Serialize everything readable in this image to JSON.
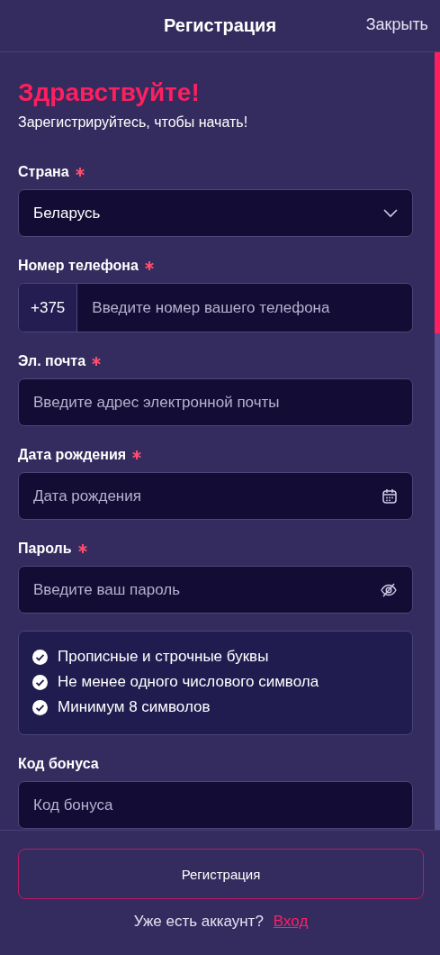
{
  "header": {
    "title": "Регистрация",
    "close": "Закрыть"
  },
  "greeting": {
    "title": "Здравствуйте!",
    "subtitle": "Зарегистрируйтесь, чтобы начать!"
  },
  "fields": [
    {
      "kind": "select",
      "label": "Страна",
      "required": true,
      "value": "Беларусь"
    },
    {
      "kind": "phone",
      "label": "Номер телефона",
      "required": true,
      "prefix": "+375",
      "placeholder": "Введите номер вашего телефона"
    },
    {
      "kind": "text",
      "label": "Эл. почта",
      "required": true,
      "placeholder": "Введите адрес электронной почты"
    },
    {
      "kind": "date",
      "label": "Дата рождения",
      "required": true,
      "placeholder": "Дата рождения"
    },
    {
      "kind": "password",
      "label": "Пароль",
      "required": true,
      "placeholder": "Введите ваш пароль",
      "rules": [
        {
          "text": "Прописные и строчные буквы",
          "met": true
        },
        {
          "text": "Не менее одного числового символа",
          "met": true
        },
        {
          "text": "Минимум 8 символов",
          "met": true
        }
      ]
    },
    {
      "kind": "text",
      "label": "Код бонуса",
      "required": false,
      "placeholder": "Код бонуса"
    }
  ],
  "footer": {
    "button": "Регистрация",
    "prompt": "Уже есть аккаунт?",
    "link": "Вход"
  }
}
